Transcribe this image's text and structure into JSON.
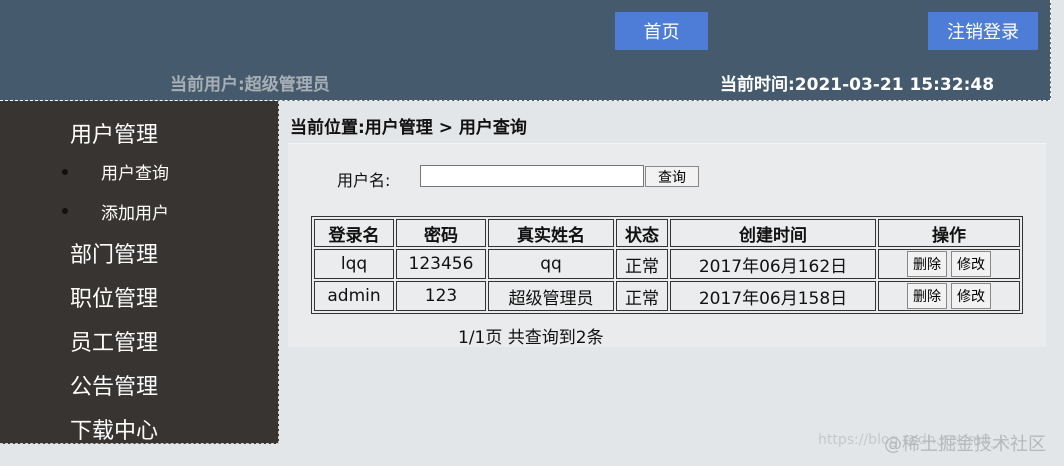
{
  "header": {
    "home_label": "首页",
    "logout_label": "注销登录",
    "current_user": "当前用户:超级管理员",
    "current_time": "当前时间:2021-03-21 15:32:48"
  },
  "sidebar": {
    "groups": [
      {
        "label": "用户管理"
      },
      {
        "label": "部门管理"
      },
      {
        "label": "职位管理"
      },
      {
        "label": "员工管理"
      },
      {
        "label": "公告管理"
      },
      {
        "label": "下载中心"
      }
    ],
    "user_sub_items": [
      {
        "label": "用户查询"
      },
      {
        "label": "添加用户"
      }
    ]
  },
  "main": {
    "breadcrumb": "当前位置:用户管理 > 用户查询",
    "search": {
      "label": "用户名:",
      "value": "",
      "button_label": "查询"
    },
    "table": {
      "columns": [
        "登录名",
        "密码",
        "真实姓名",
        "状态",
        "创建时间",
        "操作"
      ],
      "rows": [
        {
          "login": "lqq",
          "password": "123456",
          "real_name": "qq",
          "status": "正常",
          "created": "2017年06月162日",
          "delete_label": "删除",
          "edit_label": "修改"
        },
        {
          "login": "admin",
          "password": "123",
          "real_name": "超级管理员",
          "status": "正常",
          "created": "2017年06月158日",
          "delete_label": "删除",
          "edit_label": "修改"
        }
      ]
    },
    "pager": "1/1页 共查询到2条"
  },
  "watermark": {
    "url": "https://blog.csdn.net/m0_...",
    "brand": "@稀土掘金技术社区"
  }
}
